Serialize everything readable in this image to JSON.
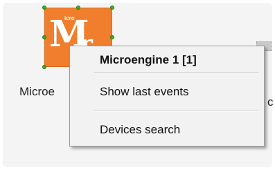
{
  "device": {
    "label": "Microengine 1",
    "label_visible": "Microe",
    "logo_big_letter": "M",
    "logo_second_letter": "r",
    "logo_small_text": "icro",
    "icon": "microengine-logo-icon"
  },
  "neighbor": {
    "label_fragment": "c",
    "icon": "device-icon"
  },
  "context_menu": {
    "title": "Microengine 1 [1]",
    "items": [
      {
        "label": "Show last events"
      },
      {
        "label": "Devices search"
      }
    ]
  },
  "colors": {
    "device_orange": "#f07e2c",
    "selection_handle": "#3db11f"
  }
}
